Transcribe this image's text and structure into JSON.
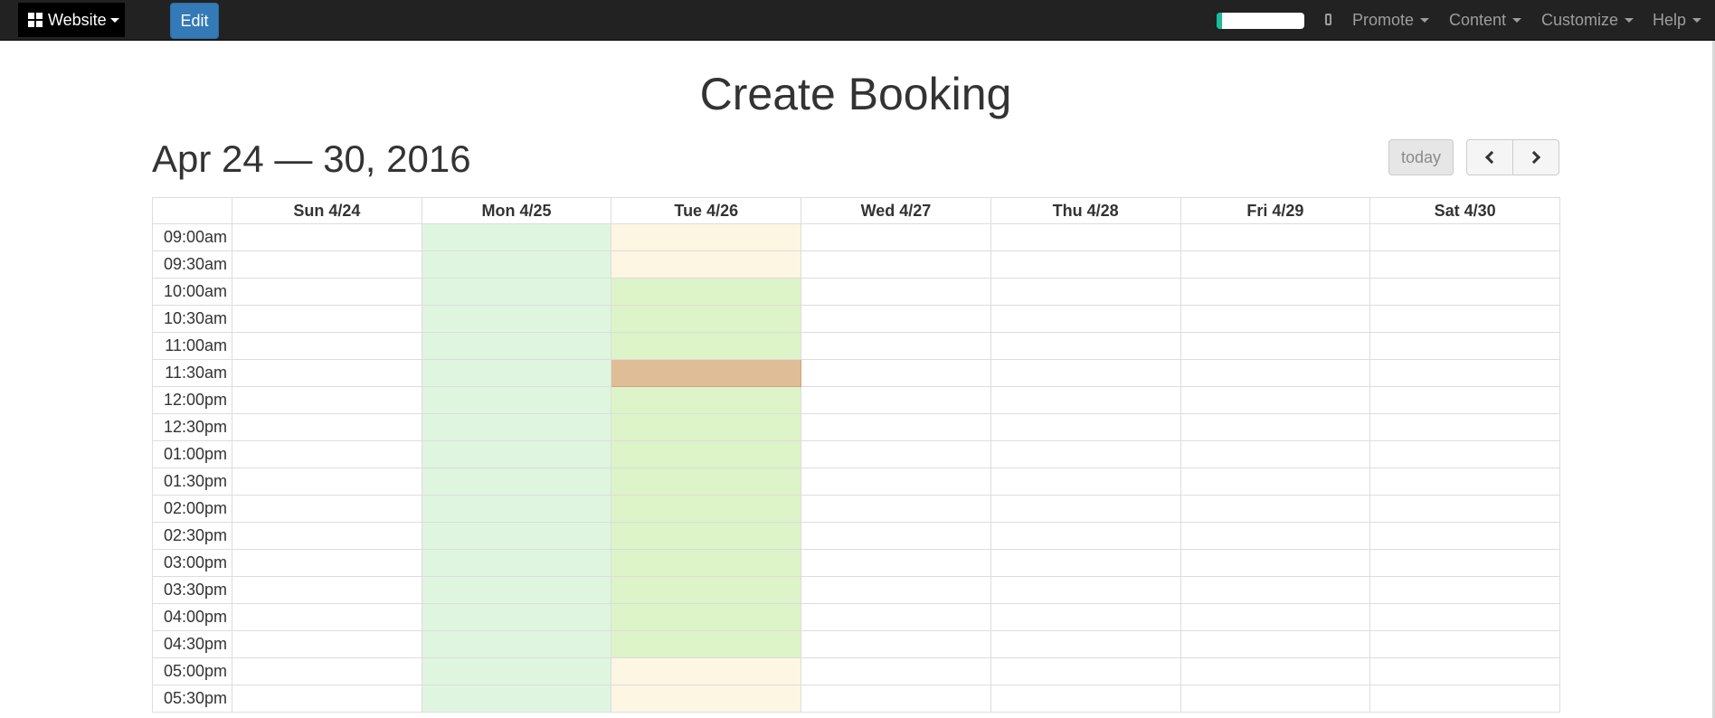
{
  "navbar": {
    "brand_label": "Website",
    "edit_label": "Edit",
    "progress_fraction": 0.06,
    "menus": [
      {
        "label": "Promote"
      },
      {
        "label": "Content"
      },
      {
        "label": "Customize"
      },
      {
        "label": "Help"
      }
    ]
  },
  "page": {
    "title": "Create Booking",
    "date_range": "Apr 24 — 30, 2016",
    "today_label": "today"
  },
  "calendar": {
    "days": [
      "Sun 4/24",
      "Mon 4/25",
      "Tue 4/26",
      "Wed 4/27",
      "Thu 4/28",
      "Fri 4/29",
      "Sat 4/30"
    ],
    "times": [
      "09:00am",
      "09:30am",
      "10:00am",
      "10:30am",
      "11:00am",
      "11:30am",
      "12:00pm",
      "12:30pm",
      "01:00pm",
      "01:30pm",
      "02:00pm",
      "02:30pm",
      "03:00pm",
      "03:30pm",
      "04:00pm",
      "04:30pm",
      "05:00pm",
      "05:30pm"
    ],
    "slot_states": {
      "Mon 4/25": [
        "available",
        "available",
        "available",
        "available",
        "available",
        "available",
        "available",
        "available",
        "available",
        "available",
        "available",
        "available",
        "available",
        "available",
        "available",
        "available",
        "available",
        "available"
      ],
      "Tue 4/26": [
        "pending",
        "pending",
        "available",
        "available",
        "available",
        "booked",
        "available",
        "available",
        "available",
        "available",
        "available",
        "available",
        "available",
        "available",
        "available",
        "available",
        "pending",
        "pending"
      ]
    }
  },
  "colors": {
    "navbar_bg": "#222222",
    "edit_button": "#337ab7",
    "progress_fill": "#1abc9c",
    "mon_available": "#dff5df",
    "tue_available": "#ddf3c8",
    "pending": "#fcf6e3",
    "booked": "#dfbd96"
  }
}
